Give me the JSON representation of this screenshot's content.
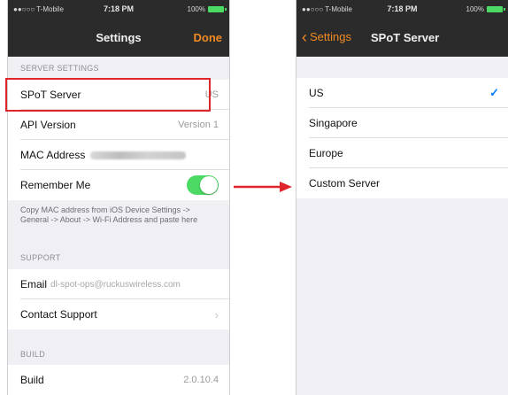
{
  "left_screen": {
    "status_bar": {
      "carrier": "●●○○○ T-Mobile",
      "time": "7:18 PM",
      "battery": "100%"
    },
    "nav": {
      "title": "Settings",
      "done_label": "Done"
    },
    "server_settings": {
      "header": "SERVER SETTINGS",
      "spot_server": {
        "label": "SPoT Server",
        "value": "US"
      },
      "api_version": {
        "label": "API Version",
        "value": "Version 1"
      },
      "mac_address": {
        "label": "MAC Address"
      },
      "remember_me": {
        "label": "Remember Me",
        "enabled": true
      }
    },
    "note": "Copy MAC address from iOS Device Settings -> General -> About -> Wi-Fi Address and paste here",
    "support": {
      "header": "SUPPORT",
      "email": {
        "label": "Email",
        "value": "dl-spot-ops@ruckuswireless.com"
      },
      "contact": {
        "label": "Contact Support"
      }
    },
    "build": {
      "header": "BUILD",
      "row": {
        "label": "Build",
        "value": "2.0.10.4"
      }
    }
  },
  "right_screen": {
    "status_bar": {
      "carrier": "●●○○○ T-Mobile",
      "time": "7:18 PM",
      "battery": "100%"
    },
    "nav": {
      "back_label": "Settings",
      "title": "SPoT Server"
    },
    "options": [
      {
        "label": "US",
        "selected": true
      },
      {
        "label": "Singapore",
        "selected": false
      },
      {
        "label": "Europe",
        "selected": false
      },
      {
        "label": "Custom Server",
        "selected": false
      }
    ]
  },
  "colors": {
    "accent": "#f08a24",
    "highlight": "#e0242b",
    "toggle_on": "#4cd964",
    "check": "#007aff",
    "nav_bg": "#2b2b2b"
  },
  "icons": {
    "check": "checkmark-icon",
    "back": "chevron-left-icon",
    "disclosure": "chevron-right-icon",
    "arrow": "arrow-right-icon"
  }
}
